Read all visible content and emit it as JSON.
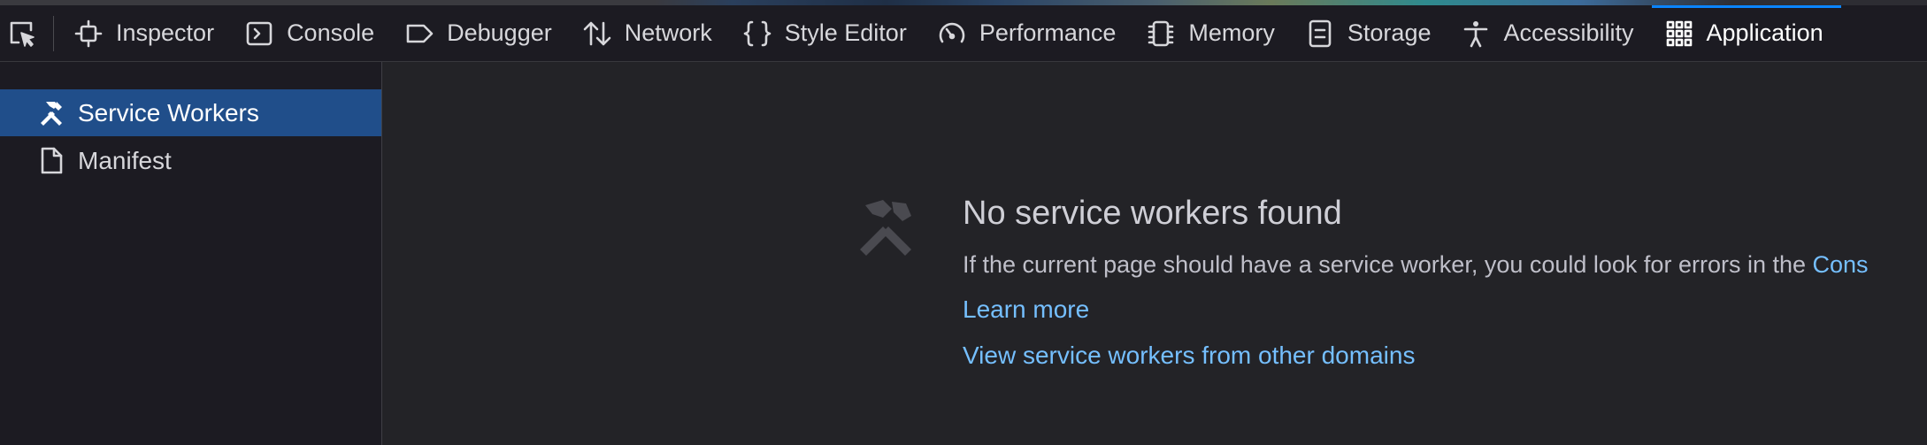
{
  "toolbar": {
    "picker": {
      "icon": "element-picker-icon"
    },
    "tabs": [
      {
        "label": "Inspector",
        "icon": "inspector-icon"
      },
      {
        "label": "Console",
        "icon": "console-icon"
      },
      {
        "label": "Debugger",
        "icon": "debugger-icon"
      },
      {
        "label": "Network",
        "icon": "network-icon"
      },
      {
        "label": "Style Editor",
        "icon": "style-editor-icon"
      },
      {
        "label": "Performance",
        "icon": "performance-icon"
      },
      {
        "label": "Memory",
        "icon": "memory-icon"
      },
      {
        "label": "Storage",
        "icon": "storage-icon"
      },
      {
        "label": "Accessibility",
        "icon": "accessibility-icon"
      },
      {
        "label": "Application",
        "icon": "application-icon",
        "selected": true
      }
    ]
  },
  "sidebar": {
    "items": [
      {
        "label": "Service Workers",
        "icon": "service-workers-icon",
        "selected": true
      },
      {
        "label": "Manifest",
        "icon": "manifest-icon",
        "selected": false
      }
    ]
  },
  "main": {
    "empty_title": "No service workers found",
    "empty_description": "If the current page should have a service worker, you could look for errors in the ",
    "console_link": "Cons",
    "learn_more": "Learn more",
    "view_other_domains": "View service workers from other domains"
  },
  "colors": {
    "toolbar_bg": "#1c1b22",
    "content_bg": "#232327",
    "selected_item_bg": "#204e8a",
    "selected_tab_accent": "#0a84ff",
    "link": "#75bfff"
  }
}
